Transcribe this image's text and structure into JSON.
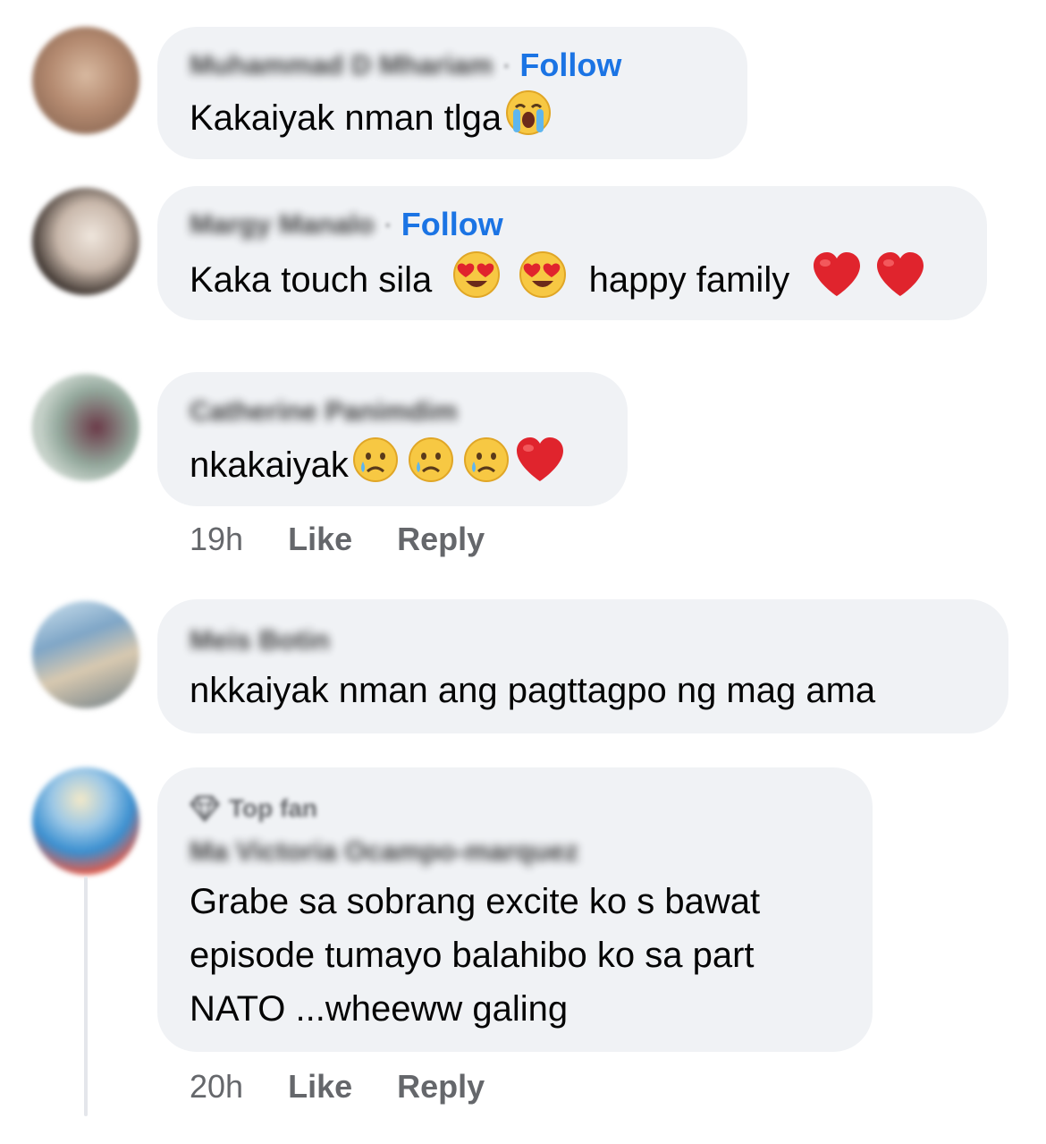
{
  "comments": [
    {
      "author": "Muhammad D Mhariam",
      "follow_label": "Follow",
      "text": "Kakaiyak nman tlga",
      "emojis": [
        "loudly-crying-face"
      ],
      "avatar_colors": [
        "#c9a58a",
        "#8a6a55"
      ]
    },
    {
      "author": "Margy Manalo",
      "follow_label": "Follow",
      "text_before": "Kaka touch sila",
      "text_after": "happy family",
      "emojis_mid": [
        "heart-eyes-face",
        "heart-eyes-face"
      ],
      "emojis_end": [
        "red-heart",
        "red-heart"
      ],
      "avatar_colors": [
        "#e9e2dc",
        "#3a302b"
      ]
    },
    {
      "author": "Catherine Panimdim",
      "text": "nkakaiyak",
      "emojis": [
        "crying-face",
        "crying-face",
        "crying-face",
        "red-heart"
      ],
      "time": "19h",
      "like_label": "Like",
      "reply_label": "Reply",
      "avatar_colors": [
        "#8aa59a",
        "#5a3a45"
      ]
    },
    {
      "author": "Meis Botin",
      "text": "nkkaiyak nman ang pagttagpo ng mag ama",
      "avatar_colors": [
        "#7ea3c4",
        "#c8b49a"
      ]
    },
    {
      "badge": "Top fan",
      "author": "Ma Victoria Ocampo-marquez",
      "text": "Grabe sa sobrang excite ko s bawat episode tumayo balahibo ko sa part NATO ...wheeww galing",
      "time": "20h",
      "like_label": "Like",
      "reply_label": "Reply",
      "avatar_colors": [
        "#4aa3d8",
        "#e7473c"
      ]
    }
  ],
  "colors": {
    "bubble": "#f0f2f5",
    "link": "#1b74e4",
    "muted": "#65676b",
    "heart": "#e0242d"
  }
}
